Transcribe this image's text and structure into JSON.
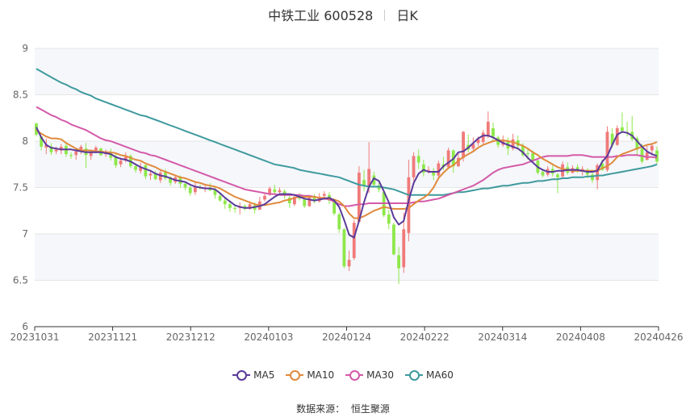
{
  "header": {
    "title": "中铁工业 600528",
    "period": "日K"
  },
  "source": {
    "label": "数据来源：",
    "value": "恒生聚源"
  },
  "colors": {
    "up": "#f07a7a",
    "down": "#8ee84a",
    "grid": "#e6e6e6",
    "band": "#f5f7fb",
    "axis_text": "#666666",
    "MA5": "#5b3a9a",
    "MA10": "#e08a3c",
    "MA30": "#d45aa8",
    "MA60": "#3f9a9d"
  },
  "chart_data": {
    "type": "candlestick",
    "title": "中铁工业 600528 日K",
    "ylim": [
      6,
      9
    ],
    "yticks": [
      "9",
      "8.5",
      "8",
      "7.5",
      "7",
      "6.5",
      "6"
    ],
    "xtick_labels": [
      "20231031",
      "20231121",
      "20231212",
      "20240103",
      "20240124",
      "20240222",
      "20240314",
      "20240408",
      "20240426"
    ],
    "legend": [
      {
        "key": "MA5",
        "label": "MA5"
      },
      {
        "key": "MA10",
        "label": "MA10"
      },
      {
        "key": "MA30",
        "label": "MA30"
      },
      {
        "key": "MA60",
        "label": "MA60"
      }
    ],
    "candles": [
      [
        8.19,
        8.07,
        8.2,
        8.05
      ],
      [
        8.05,
        7.94,
        8.05,
        7.9
      ],
      [
        7.93,
        7.96,
        8.03,
        7.86
      ],
      [
        7.94,
        7.88,
        7.98,
        7.85
      ],
      [
        7.89,
        7.91,
        7.94,
        7.86
      ],
      [
        7.9,
        7.94,
        7.97,
        7.86
      ],
      [
        7.95,
        7.86,
        7.98,
        7.83
      ],
      [
        7.85,
        7.84,
        7.88,
        7.81
      ],
      [
        7.85,
        7.89,
        7.92,
        7.8
      ],
      [
        7.89,
        7.94,
        7.96,
        7.86
      ],
      [
        7.92,
        7.85,
        7.98,
        7.71
      ],
      [
        7.84,
        7.88,
        7.9,
        7.8
      ],
      [
        7.88,
        7.93,
        7.95,
        7.87
      ],
      [
        7.92,
        7.85,
        7.93,
        7.84
      ],
      [
        7.86,
        7.89,
        7.91,
        7.83
      ],
      [
        7.88,
        7.82,
        7.92,
        7.79
      ],
      [
        7.83,
        7.74,
        7.86,
        7.71
      ],
      [
        7.75,
        7.79,
        7.82,
        7.72
      ],
      [
        7.79,
        7.83,
        7.88,
        7.77
      ],
      [
        7.84,
        7.73,
        7.86,
        7.71
      ],
      [
        7.73,
        7.69,
        7.76,
        7.66
      ],
      [
        7.68,
        7.72,
        7.77,
        7.65
      ],
      [
        7.74,
        7.62,
        7.75,
        7.59
      ],
      [
        7.63,
        7.65,
        7.69,
        7.58
      ],
      [
        7.65,
        7.59,
        7.68,
        7.58
      ],
      [
        7.58,
        7.66,
        7.69,
        7.55
      ],
      [
        7.67,
        7.6,
        7.7,
        7.58
      ],
      [
        7.61,
        7.55,
        7.62,
        7.52
      ],
      [
        7.56,
        7.61,
        7.64,
        7.54
      ],
      [
        7.61,
        7.54,
        7.63,
        7.5
      ],
      [
        7.54,
        7.5,
        7.56,
        7.47
      ],
      [
        7.5,
        7.44,
        7.52,
        7.41
      ],
      [
        7.45,
        7.5,
        7.55,
        7.42
      ],
      [
        7.5,
        7.49,
        7.53,
        7.48
      ],
      [
        7.49,
        7.5,
        7.52,
        7.45
      ],
      [
        7.5,
        7.47,
        7.55,
        7.46
      ],
      [
        7.48,
        7.42,
        7.5,
        7.38
      ],
      [
        7.41,
        7.36,
        7.44,
        7.35
      ],
      [
        7.36,
        7.32,
        7.39,
        7.27
      ],
      [
        7.32,
        7.28,
        7.34,
        7.24
      ],
      [
        7.28,
        7.27,
        7.3,
        7.23
      ],
      [
        7.28,
        7.3,
        7.34,
        7.21
      ],
      [
        7.3,
        7.27,
        7.32,
        7.25
      ],
      [
        7.27,
        7.32,
        7.35,
        7.26
      ],
      [
        7.31,
        7.26,
        7.34,
        7.22
      ],
      [
        7.26,
        7.35,
        7.4,
        7.26
      ],
      [
        7.37,
        7.41,
        7.44,
        7.35
      ],
      [
        7.43,
        7.49,
        7.51,
        7.41
      ],
      [
        7.48,
        7.45,
        7.53,
        7.43
      ],
      [
        7.45,
        7.47,
        7.5,
        7.44
      ],
      [
        7.46,
        7.41,
        7.48,
        7.38
      ],
      [
        7.39,
        7.33,
        7.41,
        7.28
      ],
      [
        7.32,
        7.4,
        7.42,
        7.3
      ],
      [
        7.4,
        7.38,
        7.44,
        7.36
      ],
      [
        7.37,
        7.3,
        7.38,
        7.28
      ],
      [
        7.3,
        7.39,
        7.41,
        7.29
      ],
      [
        7.39,
        7.35,
        7.43,
        7.33
      ],
      [
        7.35,
        7.4,
        7.44,
        7.34
      ],
      [
        7.41,
        7.43,
        7.46,
        7.37
      ],
      [
        7.42,
        7.36,
        7.45,
        7.32
      ],
      [
        7.36,
        7.22,
        7.37,
        7.2
      ],
      [
        7.21,
        7.05,
        7.23,
        7.01
      ],
      [
        7.05,
        6.65,
        7.06,
        6.63
      ],
      [
        6.65,
        6.72,
        6.82,
        6.6
      ],
      [
        6.74,
        7.12,
        7.15,
        6.72
      ],
      [
        7.13,
        7.66,
        7.73,
        7.12
      ],
      [
        7.58,
        7.52,
        7.69,
        7.46
      ],
      [
        7.52,
        7.7,
        7.99,
        7.44
      ],
      [
        7.63,
        7.53,
        7.67,
        7.52
      ],
      [
        7.52,
        7.48,
        7.55,
        7.45
      ],
      [
        7.45,
        7.2,
        7.47,
        7.18
      ],
      [
        7.21,
        7.11,
        7.26,
        7.05
      ],
      [
        7.1,
        6.78,
        7.12,
        6.77
      ],
      [
        6.77,
        6.63,
        6.86,
        6.46
      ],
      [
        6.64,
        7.05,
        7.23,
        6.58
      ],
      [
        7.01,
        7.61,
        7.8,
        6.92
      ],
      [
        7.61,
        7.84,
        7.88,
        7.57
      ],
      [
        7.84,
        7.77,
        7.91,
        7.7
      ],
      [
        7.75,
        7.66,
        7.8,
        7.62
      ],
      [
        7.68,
        7.69,
        7.73,
        7.65
      ],
      [
        7.68,
        7.63,
        7.71,
        7.58
      ],
      [
        7.63,
        7.76,
        7.79,
        7.6
      ],
      [
        7.75,
        7.72,
        7.83,
        7.69
      ],
      [
        7.72,
        7.9,
        7.93,
        7.7
      ],
      [
        7.9,
        7.73,
        7.91,
        7.66
      ],
      [
        7.73,
        7.82,
        7.87,
        7.72
      ],
      [
        7.82,
        8.1,
        8.11,
        7.78
      ],
      [
        7.96,
        7.91,
        8.07,
        7.88
      ],
      [
        7.92,
        7.97,
        8.04,
        7.88
      ],
      [
        7.98,
        8.02,
        8.05,
        7.95
      ],
      [
        7.99,
        8.09,
        8.12,
        7.97
      ],
      [
        8.05,
        8.21,
        8.32,
        8.03
      ],
      [
        8.14,
        8.05,
        8.2,
        7.99
      ],
      [
        8.04,
        7.96,
        8.06,
        7.93
      ],
      [
        7.96,
        8.0,
        8.06,
        7.94
      ],
      [
        8.0,
        7.92,
        8.04,
        7.85
      ],
      [
        7.92,
        8.02,
        8.08,
        7.9
      ],
      [
        8.01,
        7.95,
        8.06,
        7.92
      ],
      [
        7.95,
        7.85,
        7.98,
        7.83
      ],
      [
        7.87,
        7.86,
        7.91,
        7.8
      ],
      [
        7.87,
        7.79,
        7.9,
        7.76
      ],
      [
        7.79,
        7.66,
        7.8,
        7.64
      ],
      [
        7.67,
        7.63,
        7.7,
        7.61
      ],
      [
        7.64,
        7.7,
        7.73,
        7.62
      ],
      [
        7.7,
        7.65,
        7.74,
        7.62
      ],
      [
        7.64,
        7.61,
        7.66,
        7.44
      ],
      [
        7.62,
        7.75,
        7.78,
        7.6
      ],
      [
        7.72,
        7.66,
        7.77,
        7.64
      ],
      [
        7.66,
        7.71,
        7.74,
        7.65
      ],
      [
        7.72,
        7.68,
        7.75,
        7.66
      ],
      [
        7.67,
        7.7,
        7.73,
        7.63
      ],
      [
        7.69,
        7.64,
        7.71,
        7.6
      ],
      [
        7.64,
        7.58,
        7.66,
        7.55
      ],
      [
        7.58,
        7.74,
        7.76,
        7.48
      ],
      [
        7.76,
        7.69,
        7.8,
        7.68
      ],
      [
        7.69,
        8.1,
        8.16,
        7.67
      ],
      [
        8.08,
        7.96,
        8.14,
        7.93
      ],
      [
        7.96,
        8.14,
        8.17,
        7.95
      ],
      [
        8.15,
        8.11,
        8.31,
        8.09
      ],
      [
        8.1,
        8.09,
        8.21,
        8.05
      ],
      [
        8.1,
        8.02,
        8.27,
        8.0
      ],
      [
        8.03,
        7.91,
        8.05,
        7.84
      ],
      [
        7.92,
        7.78,
        7.97,
        7.76
      ],
      [
        7.8,
        7.88,
        7.95,
        7.79
      ],
      [
        7.9,
        7.95,
        7.98,
        7.85
      ],
      [
        7.9,
        7.78,
        7.94,
        7.75
      ]
    ],
    "series": {
      "MA5": [
        8.15,
        8.04,
        7.96,
        7.93,
        7.92,
        7.91,
        7.91,
        7.91,
        7.9,
        7.89,
        7.88,
        7.88,
        7.88,
        7.88,
        7.87,
        7.86,
        7.83,
        7.81,
        7.8,
        7.78,
        7.75,
        7.72,
        7.7,
        7.68,
        7.65,
        7.63,
        7.62,
        7.6,
        7.58,
        7.57,
        7.56,
        7.53,
        7.51,
        7.5,
        7.49,
        7.49,
        7.48,
        7.44,
        7.39,
        7.35,
        7.31,
        7.29,
        7.28,
        7.28,
        7.29,
        7.3,
        7.32,
        7.36,
        7.4,
        7.43,
        7.43,
        7.43,
        7.42,
        7.4,
        7.38,
        7.37,
        7.36,
        7.37,
        7.38,
        7.39,
        7.36,
        7.29,
        7.15,
        6.99,
        6.96,
        7.14,
        7.34,
        7.51,
        7.6,
        7.57,
        7.46,
        7.34,
        7.18,
        7.1,
        7.14,
        7.36,
        7.55,
        7.65,
        7.69,
        7.67,
        7.67,
        7.67,
        7.73,
        7.77,
        7.81,
        7.88,
        7.89,
        7.93,
        7.98,
        8.03,
        8.06,
        8.06,
        8.04,
        8.01,
        7.98,
        7.96,
        7.94,
        7.92,
        7.88,
        7.82,
        7.77,
        7.72,
        7.69,
        7.67,
        7.67,
        7.68,
        7.68,
        7.69,
        7.69,
        7.69,
        7.68,
        7.67,
        7.67,
        7.68,
        7.78,
        7.84,
        7.96,
        8.07,
        8.1,
        8.09,
        8.06,
        8.0,
        7.94,
        7.89,
        7.86,
        7.84
      ],
      "MA10": [
        8.12,
        8.08,
        8.05,
        8.03,
        8.03,
        8.02,
        7.98,
        7.95,
        7.92,
        7.9,
        7.9,
        7.9,
        7.89,
        7.89,
        7.88,
        7.88,
        7.87,
        7.85,
        7.84,
        7.82,
        7.8,
        7.79,
        7.76,
        7.74,
        7.72,
        7.69,
        7.67,
        7.65,
        7.63,
        7.61,
        7.6,
        7.58,
        7.56,
        7.55,
        7.53,
        7.52,
        7.51,
        7.49,
        7.46,
        7.43,
        7.4,
        7.38,
        7.36,
        7.34,
        7.32,
        7.31,
        7.31,
        7.32,
        7.33,
        7.34,
        7.36,
        7.37,
        7.39,
        7.4,
        7.4,
        7.4,
        7.4,
        7.39,
        7.39,
        7.38,
        7.37,
        7.35,
        7.3,
        7.22,
        7.17,
        7.17,
        7.19,
        7.22,
        7.25,
        7.27,
        7.29,
        7.28,
        7.27,
        7.27,
        7.27,
        7.28,
        7.32,
        7.36,
        7.39,
        7.43,
        7.5,
        7.6,
        7.66,
        7.71,
        7.74,
        7.79,
        7.83,
        7.86,
        7.89,
        7.93,
        7.96,
        7.98,
        8.0,
        8.01,
        8.01,
        8.0,
        7.99,
        7.97,
        7.95,
        7.92,
        7.88,
        7.85,
        7.81,
        7.78,
        7.75,
        7.72,
        7.7,
        7.69,
        7.68,
        7.68,
        7.68,
        7.68,
        7.68,
        7.68,
        7.71,
        7.73,
        7.77,
        7.83,
        7.86,
        7.88,
        7.9,
        7.92,
        7.94,
        7.96,
        7.97,
        7.99
      ],
      "MA30": [
        8.37,
        8.34,
        8.31,
        8.28,
        8.26,
        8.23,
        8.21,
        8.18,
        8.16,
        8.14,
        8.12,
        8.09,
        8.06,
        8.03,
        8.01,
        8.0,
        7.98,
        7.96,
        7.94,
        7.92,
        7.9,
        7.88,
        7.87,
        7.85,
        7.84,
        7.82,
        7.8,
        7.78,
        7.76,
        7.74,
        7.72,
        7.7,
        7.68,
        7.66,
        7.64,
        7.62,
        7.6,
        7.58,
        7.56,
        7.54,
        7.52,
        7.5,
        7.48,
        7.47,
        7.46,
        7.45,
        7.44,
        7.43,
        7.43,
        7.42,
        7.42,
        7.42,
        7.42,
        7.42,
        7.41,
        7.41,
        7.4,
        7.39,
        7.38,
        7.37,
        7.35,
        7.32,
        7.3,
        7.3,
        7.31,
        7.32,
        7.32,
        7.33,
        7.33,
        7.33,
        7.33,
        7.33,
        7.33,
        7.33,
        7.33,
        7.33,
        7.34,
        7.35,
        7.35,
        7.36,
        7.37,
        7.38,
        7.4,
        7.42,
        7.44,
        7.46,
        7.48,
        7.5,
        7.52,
        7.55,
        7.58,
        7.62,
        7.66,
        7.69,
        7.71,
        7.72,
        7.73,
        7.74,
        7.75,
        7.77,
        7.79,
        7.81,
        7.83,
        7.84,
        7.84,
        7.84,
        7.84,
        7.84,
        7.85,
        7.85,
        7.85,
        7.84,
        7.83,
        7.83,
        7.83,
        7.83,
        7.83,
        7.84,
        7.84,
        7.85,
        7.85,
        7.85,
        7.84,
        7.83,
        7.83,
        7.82
      ],
      "MA60": [
        8.78,
        8.75,
        8.72,
        8.69,
        8.66,
        8.63,
        8.61,
        8.58,
        8.56,
        8.53,
        8.51,
        8.49,
        8.46,
        8.44,
        8.42,
        8.4,
        8.38,
        8.36,
        8.34,
        8.32,
        8.3,
        8.28,
        8.27,
        8.25,
        8.23,
        8.21,
        8.19,
        8.17,
        8.15,
        8.13,
        8.11,
        8.09,
        8.07,
        8.05,
        8.03,
        8.01,
        7.99,
        7.97,
        7.95,
        7.93,
        7.91,
        7.89,
        7.87,
        7.85,
        7.83,
        7.81,
        7.79,
        7.77,
        7.75,
        7.74,
        7.73,
        7.72,
        7.71,
        7.69,
        7.68,
        7.67,
        7.66,
        7.65,
        7.64,
        7.63,
        7.62,
        7.61,
        7.59,
        7.57,
        7.55,
        7.53,
        7.52,
        7.51,
        7.51,
        7.51,
        7.5,
        7.49,
        7.48,
        7.46,
        7.44,
        7.42,
        7.42,
        7.42,
        7.42,
        7.42,
        7.42,
        7.42,
        7.42,
        7.43,
        7.44,
        7.45,
        7.45,
        7.46,
        7.47,
        7.48,
        7.49,
        7.49,
        7.5,
        7.51,
        7.52,
        7.52,
        7.53,
        7.54,
        7.55,
        7.55,
        7.56,
        7.57,
        7.57,
        7.58,
        7.59,
        7.59,
        7.6,
        7.6,
        7.61,
        7.61,
        7.61,
        7.62,
        7.62,
        7.63,
        7.63,
        7.64,
        7.65,
        7.66,
        7.67,
        7.68,
        7.69,
        7.7,
        7.71,
        7.72,
        7.73,
        7.75
      ]
    }
  }
}
